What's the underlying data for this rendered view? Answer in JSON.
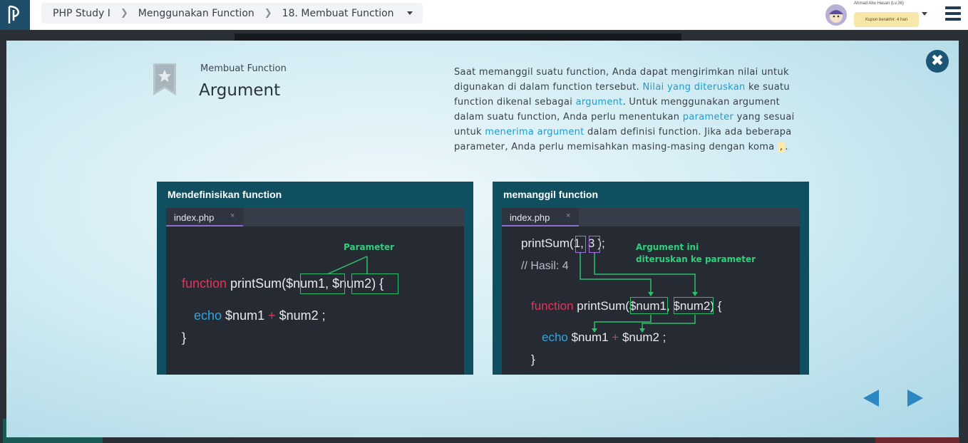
{
  "breadcrumb": {
    "course": "PHP Study I",
    "chapter": "Menggunakan Function",
    "lesson": "18. Membuat Function"
  },
  "user": {
    "name": "Ahmad Abu Hasan (Lv.36)",
    "coupon": "Kupon berakhir: 4 hari"
  },
  "slide": {
    "subtitle": "Membuat Function",
    "title": "Argument",
    "desc": {
      "p1": "Saat memanggil suatu function, Anda dapat mengirimkan nilai untuk digunakan di dalam function tersebut. ",
      "h1": "Nilai yang diteruskan",
      "p2": " ke suatu function dikenal sebagai ",
      "h2": "argument",
      "p3": ". Untuk menggunakan argument dalam suatu function, Anda perlu menentukan ",
      "h3": "parameter",
      "p4": " yang sesuai untuk ",
      "h4": "menerima argument",
      "p5": " dalam definisi function. Jika ada beberapa parameter, Anda perlu memisahkan masing-masing dengan koma ",
      "comma": ",",
      "p6": "."
    }
  },
  "panel_define": {
    "title": "Mendefinisikan function",
    "tab": "index.php",
    "tab_close": "×",
    "annotation": "Parameter",
    "kw_function": "function",
    "fn_open": " printSum(",
    "param1": "$num1",
    "sep": ", ",
    "param2": "$num2",
    "fn_close": ") {",
    "kw_echo": "echo",
    "var1": " $num1 ",
    "plus": "+",
    "var2": " $num2 ;",
    "brace": "}"
  },
  "panel_call": {
    "title": "memanggil function",
    "tab": "index.php",
    "tab_close": "×",
    "call_open": "printSum(",
    "arg1": "1",
    "sep": ",",
    "arg2": "3",
    "call_close": ");",
    "comment": "// Hasil: 4",
    "annotation_line1": "Argument ini",
    "annotation_line2": "diteruskan ke parameter",
    "kw_function": "function",
    "fn_open": " printSum(",
    "param1": "$num1",
    "param_sep": ", ",
    "param2": "$num2",
    "fn_close": ") {",
    "kw_echo": "echo",
    "var1": " $num1 ",
    "plus": "+",
    "var2": " $num2 ;",
    "brace": "}"
  },
  "icons": {
    "close": "close-icon",
    "bookmark": "bookmark-star-icon",
    "prev": "prev-arrow-icon",
    "next": "next-arrow-icon",
    "menu": "hamburger-menu-icon"
  },
  "colors": {
    "accent": "#1a9ed0",
    "panel": "#0f4f5f",
    "annotation": "#2fd07a",
    "keyword": "#e8325a"
  }
}
